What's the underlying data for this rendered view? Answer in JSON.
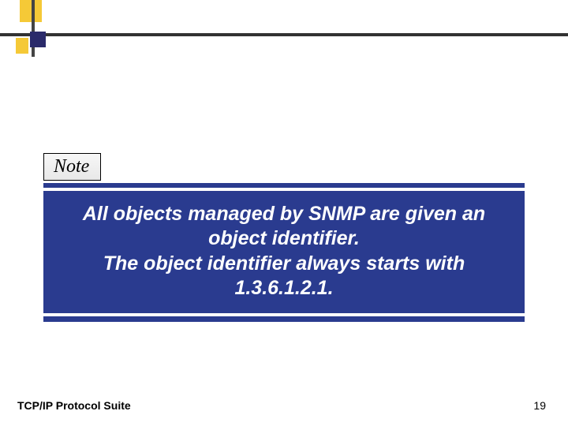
{
  "note": {
    "label": "Note",
    "line1": "All objects managed by SNMP are given an object identifier.",
    "line2": "The object identifier always starts with 1.3.6.1.2.1."
  },
  "footer": {
    "left": "TCP/IP Protocol Suite",
    "page": "19"
  }
}
